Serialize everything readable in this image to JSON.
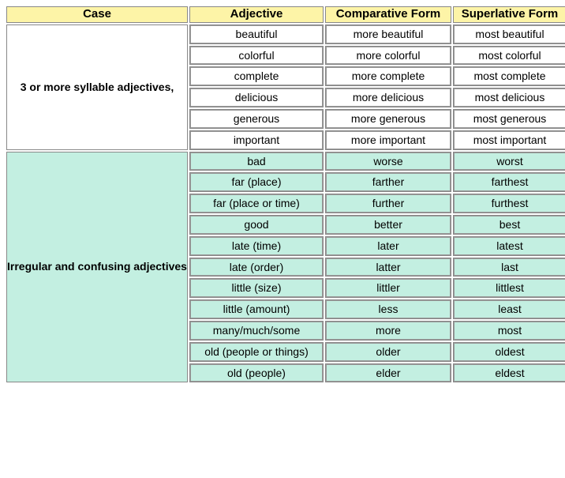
{
  "headers": {
    "case": "Case",
    "adjective": "Adjective",
    "comparative": "Comparative Form",
    "superlative": "Superlative Form"
  },
  "sections": [
    {
      "case_label": "3 or more syllable adjectives,",
      "style": "white",
      "rows": [
        {
          "adj": "beautiful",
          "comp": "more beautiful",
          "sup": "most beautiful"
        },
        {
          "adj": "colorful",
          "comp": "more colorful",
          "sup": "most colorful"
        },
        {
          "adj": "complete",
          "comp": "more complete",
          "sup": "most complete"
        },
        {
          "adj": "delicious",
          "comp": "more delicious",
          "sup": "most delicious"
        },
        {
          "adj": "generous",
          "comp": "more generous",
          "sup": "most generous"
        },
        {
          "adj": "important",
          "comp": "more important",
          "sup": "most important"
        }
      ]
    },
    {
      "case_label": "Irregular and confusing adjectives",
      "style": "green",
      "rows": [
        {
          "adj": "bad",
          "comp": "worse",
          "sup": "worst"
        },
        {
          "adj": "far (place)",
          "comp": "farther",
          "sup": "farthest"
        },
        {
          "adj": "far (place or time)",
          "comp": "further",
          "sup": "furthest"
        },
        {
          "adj": "good",
          "comp": "better",
          "sup": "best"
        },
        {
          "adj": "late (time)",
          "comp": "later",
          "sup": "latest"
        },
        {
          "adj": "late (order)",
          "comp": "latter",
          "sup": "last"
        },
        {
          "adj": "little (size)",
          "comp": "littler",
          "sup": "littlest"
        },
        {
          "adj": "little (amount)",
          "comp": "less",
          "sup": "least"
        },
        {
          "adj": "many/much/some",
          "comp": "more",
          "sup": "most"
        },
        {
          "adj": "old (people or things)",
          "comp": "older",
          "sup": "oldest"
        },
        {
          "adj": "old (people)",
          "comp": "elder",
          "sup": "eldest"
        }
      ]
    }
  ]
}
